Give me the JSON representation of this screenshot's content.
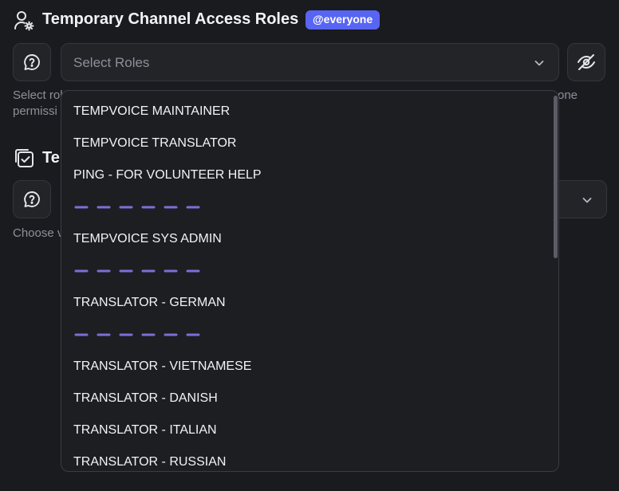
{
  "section1": {
    "title": "Temporary Channel Access Roles",
    "badge": "@everyone",
    "select_placeholder": "Select Roles",
    "helper_line1_left": "Select rol",
    "helper_line1_right": "one",
    "helper_line2": "permissi"
  },
  "section2": {
    "title_partial": "Te",
    "helper_partial": "Choose v"
  },
  "dropdown": {
    "options": [
      "TEMPVOICE MAINTAINER",
      "TEMPVOICE TRANSLATOR",
      "PING - FOR VOLUNTEER HELP",
      "TEMPVOICE SYS ADMIN",
      "TRANSLATOR - GERMAN",
      "TRANSLATOR - VIETNAMESE",
      "TRANSLATOR - DANISH",
      "TRANSLATOR - ITALIAN",
      "TRANSLATOR - RUSSIAN"
    ],
    "separator_color": "#7b6fd6"
  },
  "colors": {
    "background": "#1a1b1f",
    "accent": "#5865f2"
  },
  "icons": {
    "section1": "user-settings-icon",
    "help": "chat-help-icon",
    "chevron": "chevron-down-icon",
    "visibility": "eye-off-icon",
    "section2": "copy-check-icon"
  }
}
